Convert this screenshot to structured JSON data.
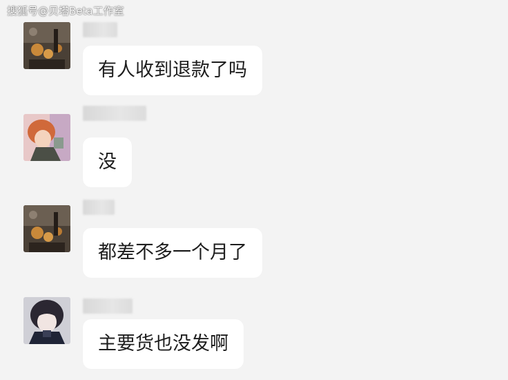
{
  "watermark": "搜狐号@贝塔Beta工作室",
  "messages": [
    {
      "avatar_icon": "dark-anime-avatar-icon",
      "text": "有人收到退款了吗"
    },
    {
      "avatar_icon": "orange-hair-anime-avatar-icon",
      "text": "没"
    },
    {
      "avatar_icon": "dark-anime-avatar-icon",
      "text": "都差不多一个月了"
    },
    {
      "avatar_icon": "dark-hair-boy-avatar-icon",
      "text": "主要货也没发啊"
    }
  ],
  "colors": {
    "background": "#f3f3f3",
    "bubble": "#ffffff",
    "text": "#1e1e1e"
  }
}
